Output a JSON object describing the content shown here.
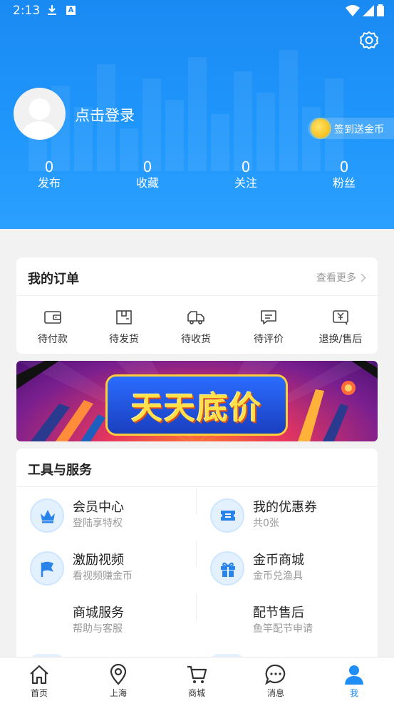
{
  "status_bar": {
    "time": "2:13"
  },
  "profile": {
    "login_text": "点击登录",
    "checkin_label": "签到送金币"
  },
  "stats": [
    {
      "value": "0",
      "label": "发布"
    },
    {
      "value": "0",
      "label": "收藏"
    },
    {
      "value": "0",
      "label": "关注"
    },
    {
      "value": "0",
      "label": "粉丝"
    }
  ],
  "orders": {
    "title": "我的订单",
    "more": "查看更多",
    "items": [
      {
        "label": "待付款",
        "icon": "wallet-icon"
      },
      {
        "label": "待发货",
        "icon": "box-icon"
      },
      {
        "label": "待收货",
        "icon": "truck-icon"
      },
      {
        "label": "待评价",
        "icon": "comment-icon"
      },
      {
        "label": "退换/售后",
        "icon": "refund-icon"
      }
    ]
  },
  "banner": {
    "text": "天天底价"
  },
  "tools": {
    "title": "工具与服务",
    "items": [
      {
        "title": "会员中心",
        "subtitle": "登陆享特权",
        "icon": "crown-icon"
      },
      {
        "title": "我的优惠券",
        "subtitle": "共0张",
        "icon": "coupon-icon"
      },
      {
        "title": "激励视频",
        "subtitle": "看视频赚金币",
        "icon": "flag-icon"
      },
      {
        "title": "金币商城",
        "subtitle": "金币兑渔具",
        "icon": "gift-icon"
      },
      {
        "title": "商城服务",
        "subtitle": "帮助与客服",
        "icon": ""
      },
      {
        "title": "配节售后",
        "subtitle": "鱼竿配节申请",
        "icon": ""
      }
    ]
  },
  "bottom_nav": [
    {
      "label": "首页",
      "icon": "home-icon"
    },
    {
      "label": "上海",
      "icon": "location-icon"
    },
    {
      "label": "商城",
      "icon": "cart-icon"
    },
    {
      "label": "消息",
      "icon": "message-icon"
    },
    {
      "label": "我",
      "icon": "user-icon",
      "active": true
    }
  ],
  "colors": {
    "primary": "#1e8ef5",
    "background": "#f2f2f2"
  }
}
